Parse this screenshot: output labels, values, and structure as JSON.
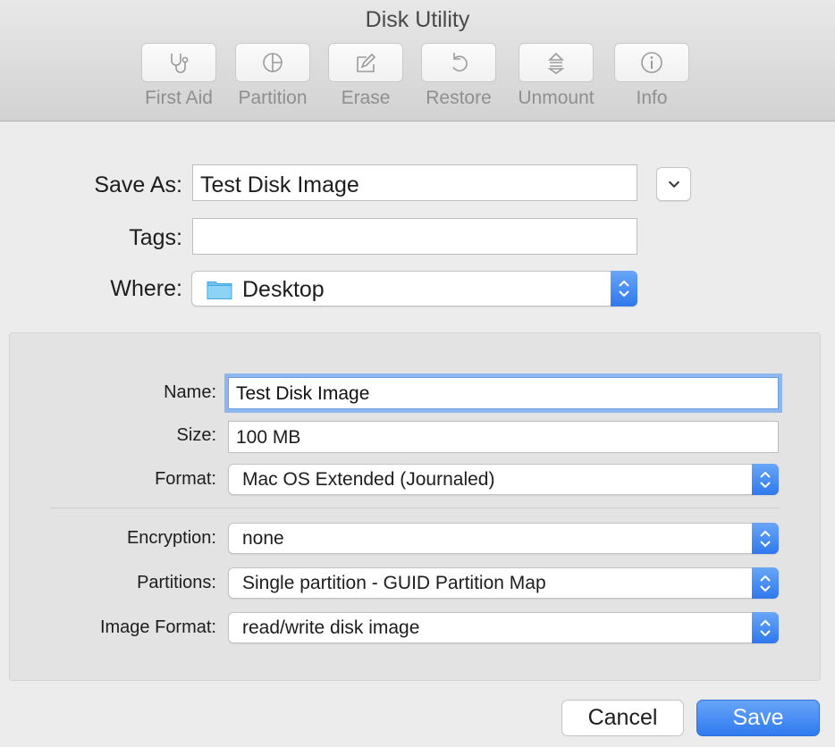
{
  "window": {
    "title": "Disk Utility"
  },
  "toolbar": {
    "items": [
      {
        "label": "First Aid",
        "icon": "stethoscope-icon"
      },
      {
        "label": "Partition",
        "icon": "pie-icon"
      },
      {
        "label": "Erase",
        "icon": "erase-icon"
      },
      {
        "label": "Restore",
        "icon": "restore-icon"
      },
      {
        "label": "Unmount",
        "icon": "eject-icon"
      },
      {
        "label": "Info",
        "icon": "info-icon"
      }
    ]
  },
  "save": {
    "save_as_label": "Save As:",
    "save_as_value": "Test Disk Image",
    "tags_label": "Tags:",
    "tags_value": "",
    "where_label": "Where:",
    "where_value": "Desktop"
  },
  "options": {
    "name_label": "Name:",
    "name_value": "Test Disk Image",
    "size_label": "Size:",
    "size_value": "100 MB",
    "format_label": "Format:",
    "format_value": "Mac OS Extended (Journaled)",
    "encryption_label": "Encryption:",
    "encryption_value": "none",
    "partitions_label": "Partitions:",
    "partitions_value": "Single partition - GUID Partition Map",
    "image_format_label": "Image Format:",
    "image_format_value": "read/write disk image"
  },
  "buttons": {
    "cancel": "Cancel",
    "save": "Save"
  },
  "colors": {
    "accent": "#2f78ec",
    "focus_ring": "#8fb7ef",
    "folder": "#6cc2f2"
  }
}
